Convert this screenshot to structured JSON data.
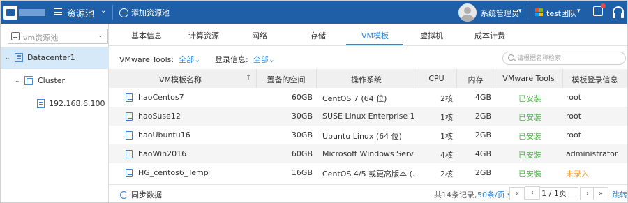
{
  "header": {
    "app_title": "资源池",
    "add_pool_label": "添加资源池",
    "user_name": "系统管理员",
    "team_name": "test团队",
    "colors": {
      "bar": "#1f5fa8",
      "accent": "#2f86d6",
      "installed": "#52b64c",
      "not_recorded": "#f3a13d"
    }
  },
  "sidebar": {
    "pool_select_placeholder": "vm资源池",
    "tree": [
      {
        "label": "Datacenter1",
        "level": 0,
        "selected": true
      },
      {
        "label": "Cluster",
        "level": 1
      },
      {
        "label": "192.168.6.100",
        "level": 2
      }
    ]
  },
  "tabs": [
    {
      "label": "基本信息"
    },
    {
      "label": "计算资源"
    },
    {
      "label": "网络"
    },
    {
      "label": "存储"
    },
    {
      "label": "VM模板",
      "active": true
    },
    {
      "label": "虚拟机"
    },
    {
      "label": "成本计费"
    }
  ],
  "filters": {
    "tools_label": "VMware Tools:",
    "tools_value": "全部",
    "login_label": "登录信息:",
    "login_value": "全部",
    "search_placeholder": "请根据名称检索"
  },
  "table": {
    "columns": [
      "VM模板名称",
      "置备的空间",
      "操作系统",
      "CPU",
      "内存",
      "VMware Tools",
      "模板登录信息"
    ],
    "rows": [
      {
        "name": "haoCentos7",
        "space": "60GB",
        "os": "CentOS 7 (64 位)",
        "cpu": "2核",
        "mem": "4GB",
        "tools": "已安装",
        "login": "root",
        "login_status": "ok"
      },
      {
        "name": "haoSuse12",
        "space": "30GB",
        "os": "SUSE Linux Enterprise 12...",
        "cpu": "1核",
        "mem": "2GB",
        "tools": "已安装",
        "login": "root",
        "login_status": "ok"
      },
      {
        "name": "haoUbuntu16",
        "space": "30GB",
        "os": "Ubuntu Linux (64 位)",
        "cpu": "1核",
        "mem": "2GB",
        "tools": "已安装",
        "login": "root",
        "login_status": "ok"
      },
      {
        "name": "haoWin2016",
        "space": "60GB",
        "os": "Microsoft Windows Serv...",
        "cpu": "4核",
        "mem": "4GB",
        "tools": "已安装",
        "login": "administrator",
        "login_status": "ok"
      },
      {
        "name": "HG_centos6_Temp",
        "space": "16GB",
        "os": "CentOS 4/5 或更高版本 (...",
        "cpu": "2核",
        "mem": "2GB",
        "tools": "已安装",
        "login": "未录入",
        "login_status": "missing"
      }
    ]
  },
  "footer": {
    "sync_label": "同步数据",
    "total_text": "共14条记录,",
    "per_page": "50条/页",
    "page_indicator": "1 / 1页",
    "jump_label": "跳转"
  }
}
